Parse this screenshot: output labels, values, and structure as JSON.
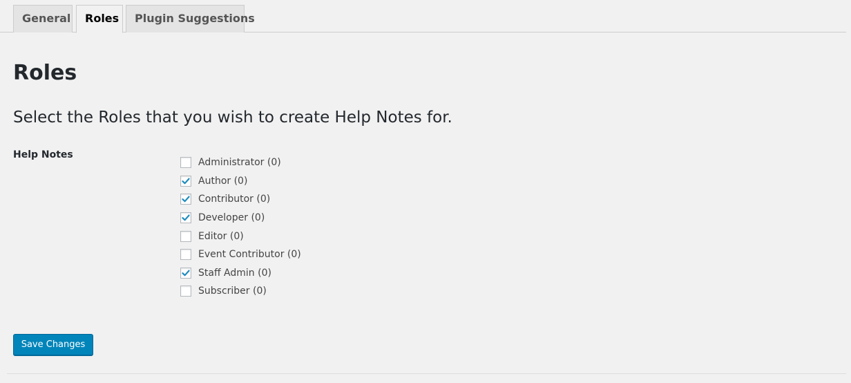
{
  "tabs": [
    {
      "label": "General",
      "active": false
    },
    {
      "label": "Roles",
      "active": true
    },
    {
      "label": "Plugin Suggestions",
      "active": false
    }
  ],
  "page": {
    "title": "Roles",
    "subtitle": "Select the Roles that you wish to create Help Notes for.",
    "field_label": "Help Notes"
  },
  "roles": [
    {
      "label": "Administrator (0)",
      "checked": false
    },
    {
      "label": "Author (0)",
      "checked": true
    },
    {
      "label": "Contributor (0)",
      "checked": true
    },
    {
      "label": "Developer (0)",
      "checked": true
    },
    {
      "label": "Editor (0)",
      "checked": false
    },
    {
      "label": "Event Contributor (0)",
      "checked": false
    },
    {
      "label": "Staff Admin (0)",
      "checked": true
    },
    {
      "label": "Subscriber (0)",
      "checked": false
    }
  ],
  "save_button": {
    "label": "Save Changes"
  },
  "colors": {
    "accent": "#0085ba",
    "check": "#1e8cbe",
    "background": "#f1f1f1"
  },
  "icons": {
    "checkmark": "check-icon"
  }
}
